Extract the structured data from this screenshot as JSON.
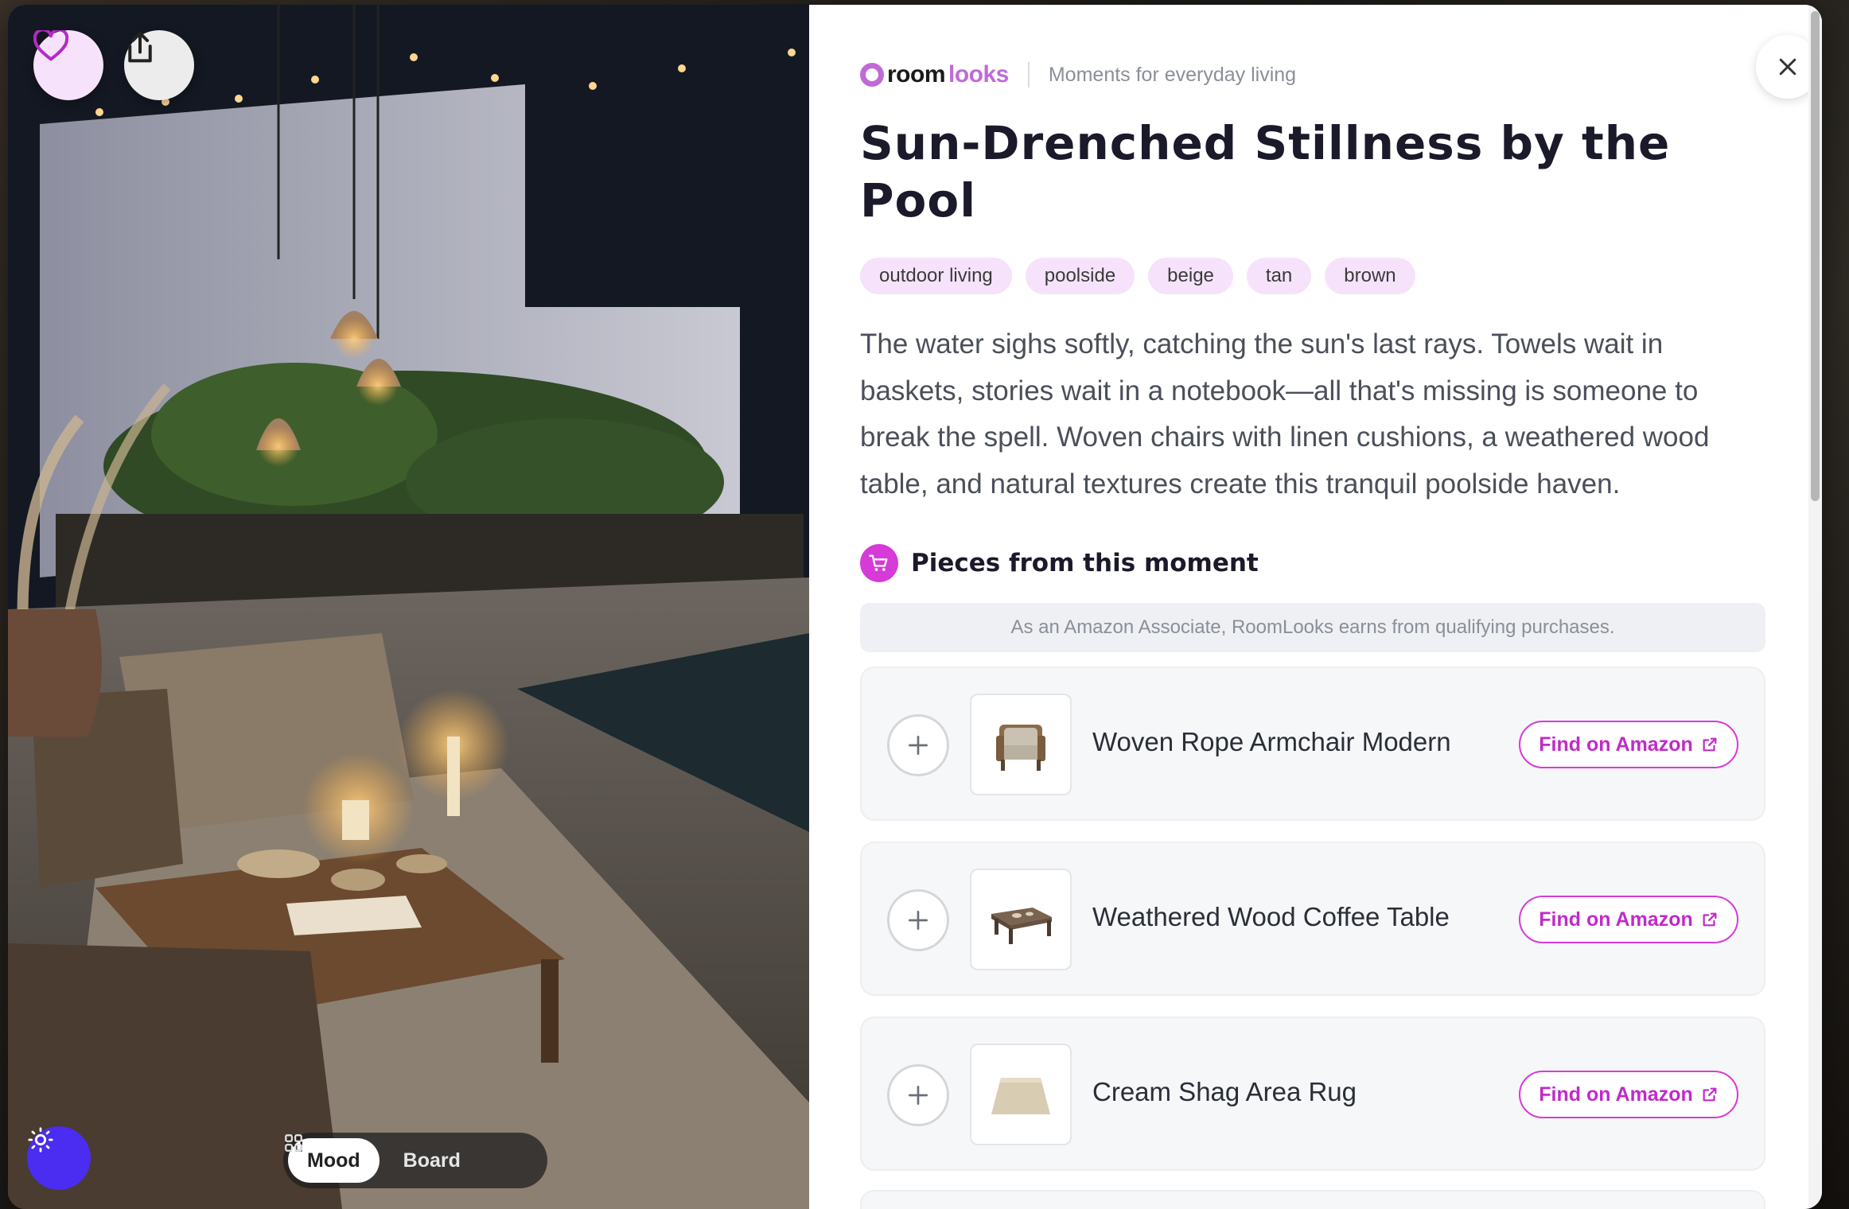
{
  "photo": {
    "favorite_label": "Favorite",
    "share_label": "Share",
    "view_toggle": [
      {
        "label": "Mood",
        "icon": "home-icon",
        "active": true
      },
      {
        "label": "Board",
        "icon": "grid-icon",
        "active": false
      }
    ]
  },
  "brand": {
    "logo_part1": "room",
    "logo_part2": "looks",
    "tagline": "Moments for everyday living"
  },
  "title": "Sun-Drenched Stillness by the Pool",
  "tags": [
    "outdoor living",
    "poolside",
    "beige",
    "tan",
    "brown"
  ],
  "description": "The water sighs softly, catching the sun's last rays. Towels wait in baskets, stories wait in a notebook—all that's missing is someone to break the spell. Woven chairs with linen cushions, a weathered wood table, and natural textures create this tranquil poolside haven.",
  "section_title": "Pieces from this moment",
  "affiliate_note": "As an Amazon Associate, RoomLooks earns from qualifying purchases.",
  "products": [
    {
      "name": "Woven Rope Armchair Modern",
      "cta": "Find on Amazon",
      "thumb_icon": "armchair-icon"
    },
    {
      "name": "Weathered Wood Coffee Table",
      "cta": "Find on Amazon",
      "thumb_icon": "coffee-table-icon"
    },
    {
      "name": "Cream Shag Area Rug",
      "cta": "Find on Amazon",
      "thumb_icon": "rug-icon"
    }
  ],
  "colors": {
    "accent": "#d63ad8",
    "tag_bg": "#f6e3fb",
    "theme_button": "#4a2df0"
  }
}
